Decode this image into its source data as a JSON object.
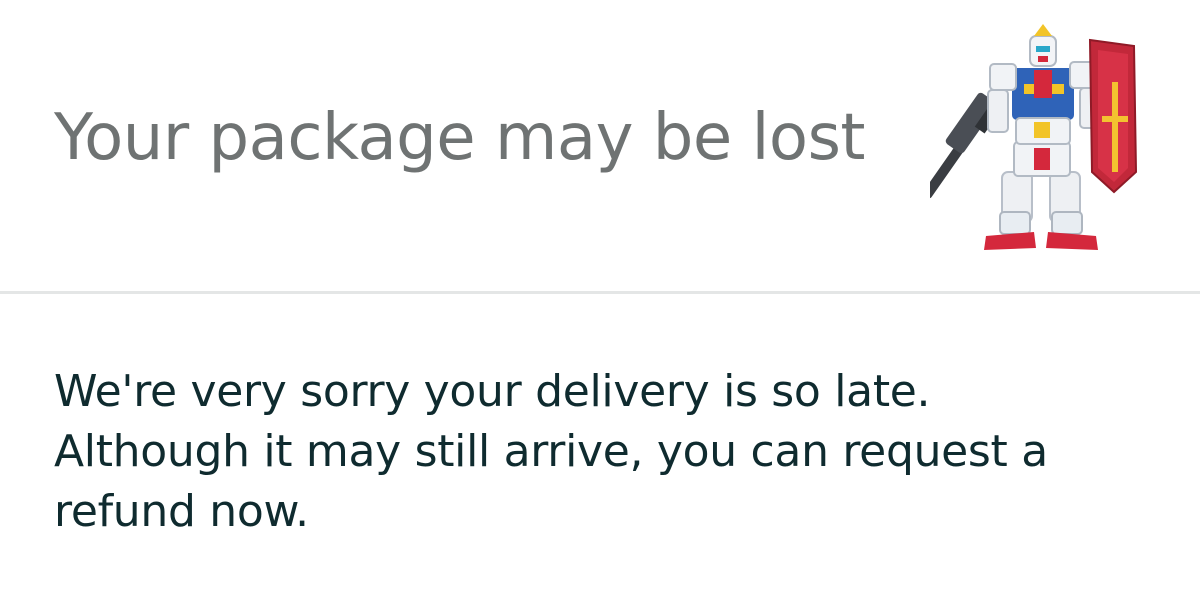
{
  "header": {
    "title": "Your package may be lost",
    "product_image": "gundam-robot-figure"
  },
  "body": {
    "lines": [
      "We're very sorry your delivery is so late.",
      "Although it may still arrive, you can request a",
      "refund now."
    ]
  },
  "colors": {
    "title": "#6f7373",
    "text": "#0f2b2f",
    "divider": "#e4e6e6",
    "background": "#ffffff"
  }
}
